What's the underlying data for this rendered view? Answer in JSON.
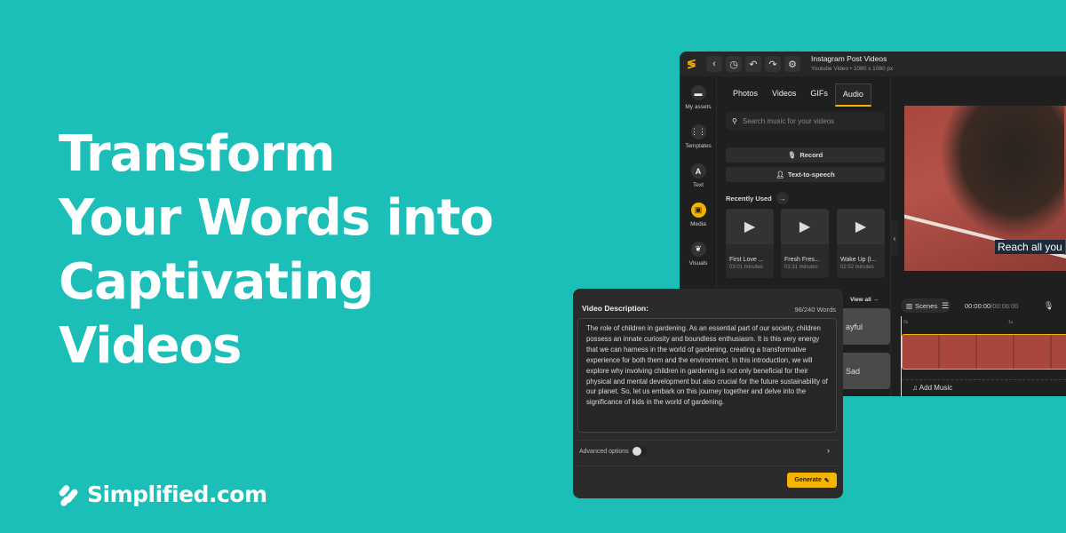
{
  "hero": {
    "lines": [
      "Transform",
      "Your Words into",
      "Captivating",
      "Videos"
    ]
  },
  "brand": {
    "name": "Simplified.com",
    "accent": "#f5b400",
    "background": "#1bbfb7"
  },
  "editor": {
    "title": "Instagram Post Videos",
    "subtitle": "Youtube Video • 1080 x 1080 px",
    "rail": [
      {
        "label": "My assets",
        "icon": "folder-icon"
      },
      {
        "label": "Templates",
        "icon": "grid-icon"
      },
      {
        "label": "Text",
        "icon": "text-icon"
      },
      {
        "label": "Media",
        "icon": "media-icon"
      },
      {
        "label": "Visuals",
        "icon": "visuals-icon"
      }
    ],
    "tabs": [
      "Photos",
      "Videos",
      "GIFs",
      "Audio"
    ],
    "active_tab": "Audio",
    "search_placeholder": "Search music for your videos",
    "record": "Record",
    "tts": "Text-to-speech",
    "recently_used": "Recently Used",
    "tracks": [
      {
        "name": "First Love ...",
        "duration": "03:01 minutes"
      },
      {
        "name": "Fresh Fres...",
        "duration": "01:31 minutes"
      },
      {
        "name": "Wake Up (I...",
        "duration": "02:52 minutes"
      }
    ],
    "view_all": "View all",
    "moods": [
      "ayful",
      "Sad"
    ],
    "caption": "Reach all you",
    "scenes": "Scenes",
    "time_current": "00:00:00",
    "time_total": "/00:06:00",
    "ruler": [
      "0s",
      "1s"
    ],
    "add_music": "Add Music"
  },
  "dialog": {
    "title": "Video Description:",
    "count": "96/240 Words",
    "text": "The role of children in gardening. As an essential part of our society, children possess an innate curiosity and boundless enthusiasm. It is this very energy that we can harness in the world of gardening, creating a transformative experience for both them and the environment. In this introduction, we will explore why involving children in gardening is not only beneficial for their physical and mental development but also crucial for the future sustainability of our planet. So, let us embark on this journey together and delve into the significance of kids in the world of gardening.",
    "advanced": "Advanced options",
    "advanced_on": false,
    "generate": "Generate"
  }
}
